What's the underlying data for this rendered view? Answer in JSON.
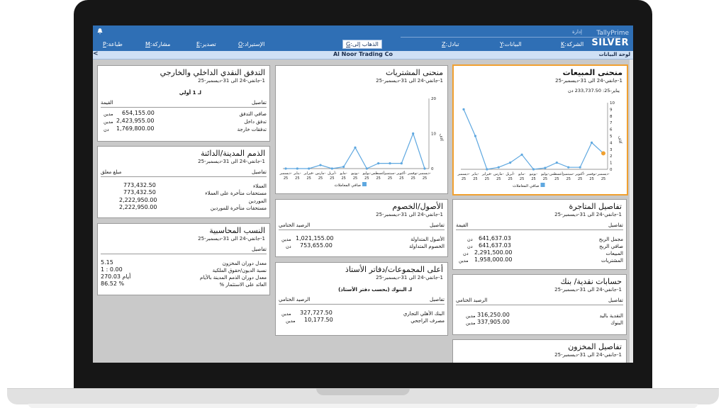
{
  "app": {
    "brand": "TallyPrime",
    "edition": "SILVER",
    "manage": "إدارة"
  },
  "menu": {
    "print": {
      "key": "P",
      "label": "طباعة"
    },
    "share": {
      "key": "M",
      "label": "مشاركة"
    },
    "export": {
      "key": "E",
      "label": "تصدير"
    },
    "import": {
      "key": "O",
      "label": "الإستيراد"
    },
    "goto": {
      "key": "G",
      "label": "الذهاب إلى"
    },
    "exchange": {
      "key": "Z",
      "label": "تبادل"
    },
    "data": {
      "key": "Y",
      "label": "البيانات"
    },
    "company": {
      "key": "K",
      "label": "الشركة"
    }
  },
  "subbar": {
    "company": "Al Noor Trading Co",
    "dashboard": "لوحة البيانات",
    "back": "<"
  },
  "period": "1-جانفي-24 الى 31-ديسمبر-25",
  "sales": {
    "title": "منحنى المبيعات",
    "last": "يناير-25: 233,737.50 دن",
    "yaxis": "آلاف",
    "legend": "صافي المعاملات",
    "ticks": [
      "10",
      "9",
      "8",
      "7",
      "6",
      "5",
      "4",
      "3",
      "2",
      "1",
      "0"
    ],
    "categories": [
      "دیسمبر-25",
      "يناير-25",
      "فبراير-25",
      "مارس-25",
      "أبريل-25",
      "مايو-25",
      "يونيو-25",
      "يوليو-25",
      "أغسطس-25",
      "سبتمبر-25",
      "أكتوبر-25",
      "نوفمبر-25",
      "ديسمبر-25"
    ]
  },
  "purchase": {
    "title": "منحنى المشتريات",
    "yaxis": "آلاف",
    "legend": "صافي المعاملات",
    "ticks": [
      "20",
      "10",
      "0"
    ],
    "categories": [
      "ديسمبر-25",
      "يناير-25",
      "فبراير-25",
      "مارس-25",
      "أبريل-25",
      "مايو-25",
      "يونيو-25",
      "يوليو-25",
      "أغسطس-25",
      "سبتمبر-25",
      "أكتوبر-25",
      "نوفمبر-25",
      "ديسمبر-25"
    ]
  },
  "chart_data": [
    {
      "type": "line",
      "title": "منحنى المبيعات",
      "ylabel": "آلاف",
      "ylim": [
        0,
        10
      ],
      "x": [
        "ديسمبر-25",
        "نوفمبر-25",
        "أكتوبر-25",
        "سبتمبر-25",
        "أغسطس-25",
        "يوليو-25",
        "يونيو-25",
        "مايو-25",
        "أبريل-25",
        "مارس-25",
        "فبراير-25",
        "يناير-25",
        "ديسمبر-25"
      ],
      "series": [
        {
          "name": "صافي المعاملات",
          "values": [
            9,
            5,
            0,
            0.3,
            1,
            2.2,
            0,
            0.2,
            1,
            0.3,
            0.3,
            4,
            2.4
          ]
        }
      ]
    },
    {
      "type": "line",
      "title": "منحنى المشتريات",
      "ylabel": "آلاف",
      "ylim": [
        0,
        20
      ],
      "x": [
        "ديسمبر-25",
        "نوفمبر-25",
        "أكتوبر-25",
        "سبتمبر-25",
        "أغسطس-25",
        "يوليو-25",
        "يونيو-25",
        "مايو-25",
        "أبريل-25",
        "مارس-25",
        "فبراير-25",
        "يناير-25",
        "ديسمبر-25"
      ],
      "series": [
        {
          "name": "صافي المعاملات",
          "values": [
            0,
            0,
            0,
            1,
            0,
            0.5,
            6,
            0,
            1.5,
            1.5,
            1.5,
            10,
            0
          ]
        }
      ]
    }
  ],
  "cashflow": {
    "title": "التدفق النقدي الداخلي والخارجي",
    "period_head": "لـ 1 أولي",
    "col_details": "تفاصيل",
    "col_value": "القيمة",
    "rows": [
      {
        "label": "صافي التدفق",
        "value": "654,155.00",
        "unit": "مدين"
      },
      {
        "label": "تدفق داخل",
        "value": "2,423,955.00",
        "unit": "مدين"
      },
      {
        "label": "تدفقات خارجة",
        "value": "1,769,800.00",
        "unit": "دن"
      }
    ]
  },
  "receivables": {
    "title": "الذمم المدينة/الدائنة",
    "col_details": "تفاصيل",
    "col_amount": "مبلغ معلق",
    "rows": [
      {
        "label": "العملاء",
        "value": "773,432.50"
      },
      {
        "label": "مستحقات متأخرة على العملاء",
        "value": "773,432.50"
      },
      {
        "label": "الموردين",
        "value": "2,222,950.00"
      },
      {
        "label": "مستحقات متأخرة للموردين",
        "value": "2,222,950.00"
      }
    ]
  },
  "ratios": {
    "title": "النسب المحاسبية",
    "col_details": "تفاصيل",
    "rows": [
      {
        "label": "معدل دوران المخزون",
        "value": "5.15"
      },
      {
        "label": "نسبة الديون/حقوق الملكية",
        "value": "1 : 0.00"
      },
      {
        "label": "معدل دوران الذمم المدينة بالأيام",
        "value": "270.03 أيام"
      },
      {
        "label": "العائد على الاستثمار %",
        "value": "86.52 %"
      }
    ]
  },
  "assets": {
    "title": "الأصول/الخصوم",
    "col_details": "تفاصيل",
    "col_closing": "الرصيد الختامي",
    "rows": [
      {
        "label": "الأصول المتداولة",
        "value": "1,021,155.00",
        "unit": "مدين"
      },
      {
        "label": "الخصوم المتداولة",
        "value": "753,655.00",
        "unit": "دن"
      }
    ]
  },
  "groups": {
    "title": "أعلى المجموعات/دفاتر الأستاذ",
    "col_details": "تفاصيل",
    "col_closing": "الرصيد الختامي",
    "head": "لـ البنوك (بحسب دفتر الأستاذ)",
    "rows": [
      {
        "label": "البنك الأهلي التجاري",
        "value": "327,727.50",
        "unit": "مدين"
      },
      {
        "label": "مصرف الراجحي",
        "value": "10,177.50",
        "unit": "مدين"
      }
    ]
  },
  "trading": {
    "title": "تفاصيل المتاجرة",
    "col_details": "تفاصيل",
    "col_value": "القيمة",
    "rows": [
      {
        "label": "مجمل الربح",
        "value": "641,637.03",
        "unit": "دن"
      },
      {
        "label": "صافي الربح",
        "value": "641,637.03",
        "unit": "دن"
      },
      {
        "label": "المبيعات",
        "value": "2,291,500.00",
        "unit": "دن"
      },
      {
        "label": "المشتريات",
        "value": "1,958,000.00",
        "unit": "مدين"
      }
    ]
  },
  "bank": {
    "title": "حسابات نقدية/ بنك",
    "col_details": "تفاصيل",
    "col_closing": "الرصيد الختامي",
    "rows": [
      {
        "label": "النقدية باليد",
        "value": "316,250.00",
        "unit": "مدين"
      },
      {
        "label": "البنوك",
        "value": "337,905.00",
        "unit": "مدين"
      }
    ]
  },
  "inventory": {
    "title": "تفاصيل المخزون"
  },
  "colors": {
    "header": "#2f6fb5",
    "line": "#5fa8e0",
    "highlight": "#f0a030"
  }
}
